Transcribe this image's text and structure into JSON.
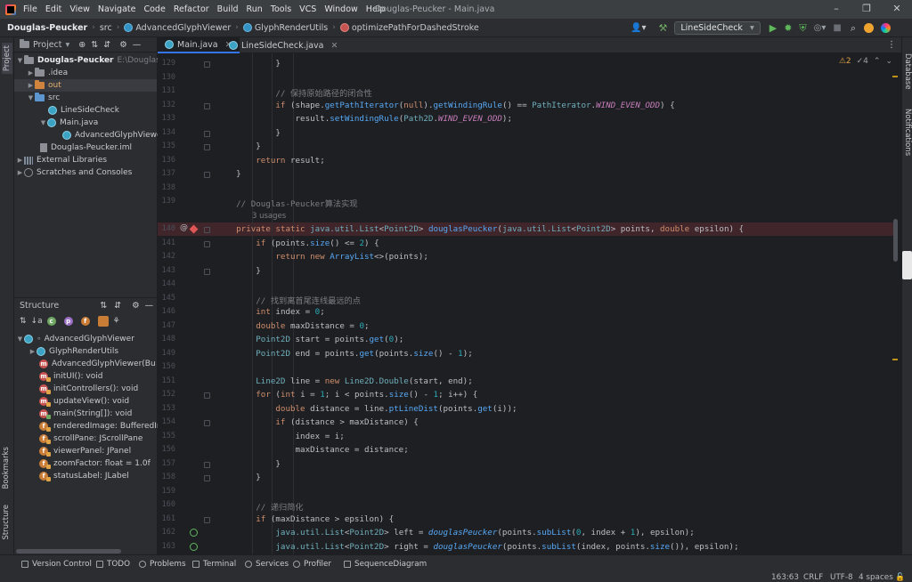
{
  "window": {
    "title": "Douglas-Peucker - Main.java",
    "menu": [
      "File",
      "Edit",
      "View",
      "Navigate",
      "Code",
      "Refactor",
      "Build",
      "Run",
      "Tools",
      "VCS",
      "Window",
      "Help"
    ]
  },
  "breadcrumb": [
    "Douglas-Peucker",
    "src",
    "AdvancedGlyphViewer",
    "GlyphRenderUtils",
    "optimizePathForDashedStroke"
  ],
  "run_config": "LineSideCheck",
  "project": {
    "header": "Project",
    "root_label": "Douglas-Peucker",
    "root_path": "E:\\Douglas-P",
    "items": [
      ".idea",
      "out",
      "src",
      "LineSideCheck",
      "Main.java",
      "AdvancedGlyphViewer",
      "Douglas-Peucker.iml",
      "External Libraries",
      "Scratches and Consoles"
    ]
  },
  "structure": {
    "header": "Structure",
    "root": "AdvancedGlyphViewer",
    "items": [
      "GlyphRenderUtils",
      "AdvancedGlyphViewer(Bu",
      "initUI(): void",
      "initControllers(): void",
      "updateView(): void",
      "main(String[]): void",
      "renderedImage: BufferedIn",
      "scrollPane: JScrollPane",
      "viewerPanel: JPanel",
      "zoomFactor: float = 1.0f",
      "statusLabel: JLabel"
    ]
  },
  "tabs": [
    "Main.java",
    "LineSideCheck.java"
  ],
  "inspections": {
    "warnings": "2",
    "weak_warnings": "4"
  },
  "editor": {
    "line_numbers": [
      "129",
      "130",
      "131",
      "132",
      "133",
      "134",
      "135",
      "136",
      "137",
      "138",
      "139",
      "140",
      "141",
      "142",
      "143",
      "144",
      "145",
      "146",
      "147",
      "148",
      "149",
      "150",
      "151",
      "152",
      "153",
      "154",
      "155",
      "156",
      "157",
      "158",
      "159",
      "160",
      "161",
      "162",
      "163"
    ],
    "usages": "3 usages"
  },
  "left_tools": [
    "Project",
    "Bookmarks",
    "Structure"
  ],
  "right_tools": [
    "Database",
    "Notifications"
  ],
  "bottom_tabs": [
    "Version Control",
    "TODO",
    "Problems",
    "Terminal",
    "Services",
    "Profiler",
    "SequenceDiagram"
  ],
  "status": {
    "position": "163:63",
    "line_sep": "CRLF",
    "encoding": "UTF-8",
    "indent": "4 spaces"
  }
}
